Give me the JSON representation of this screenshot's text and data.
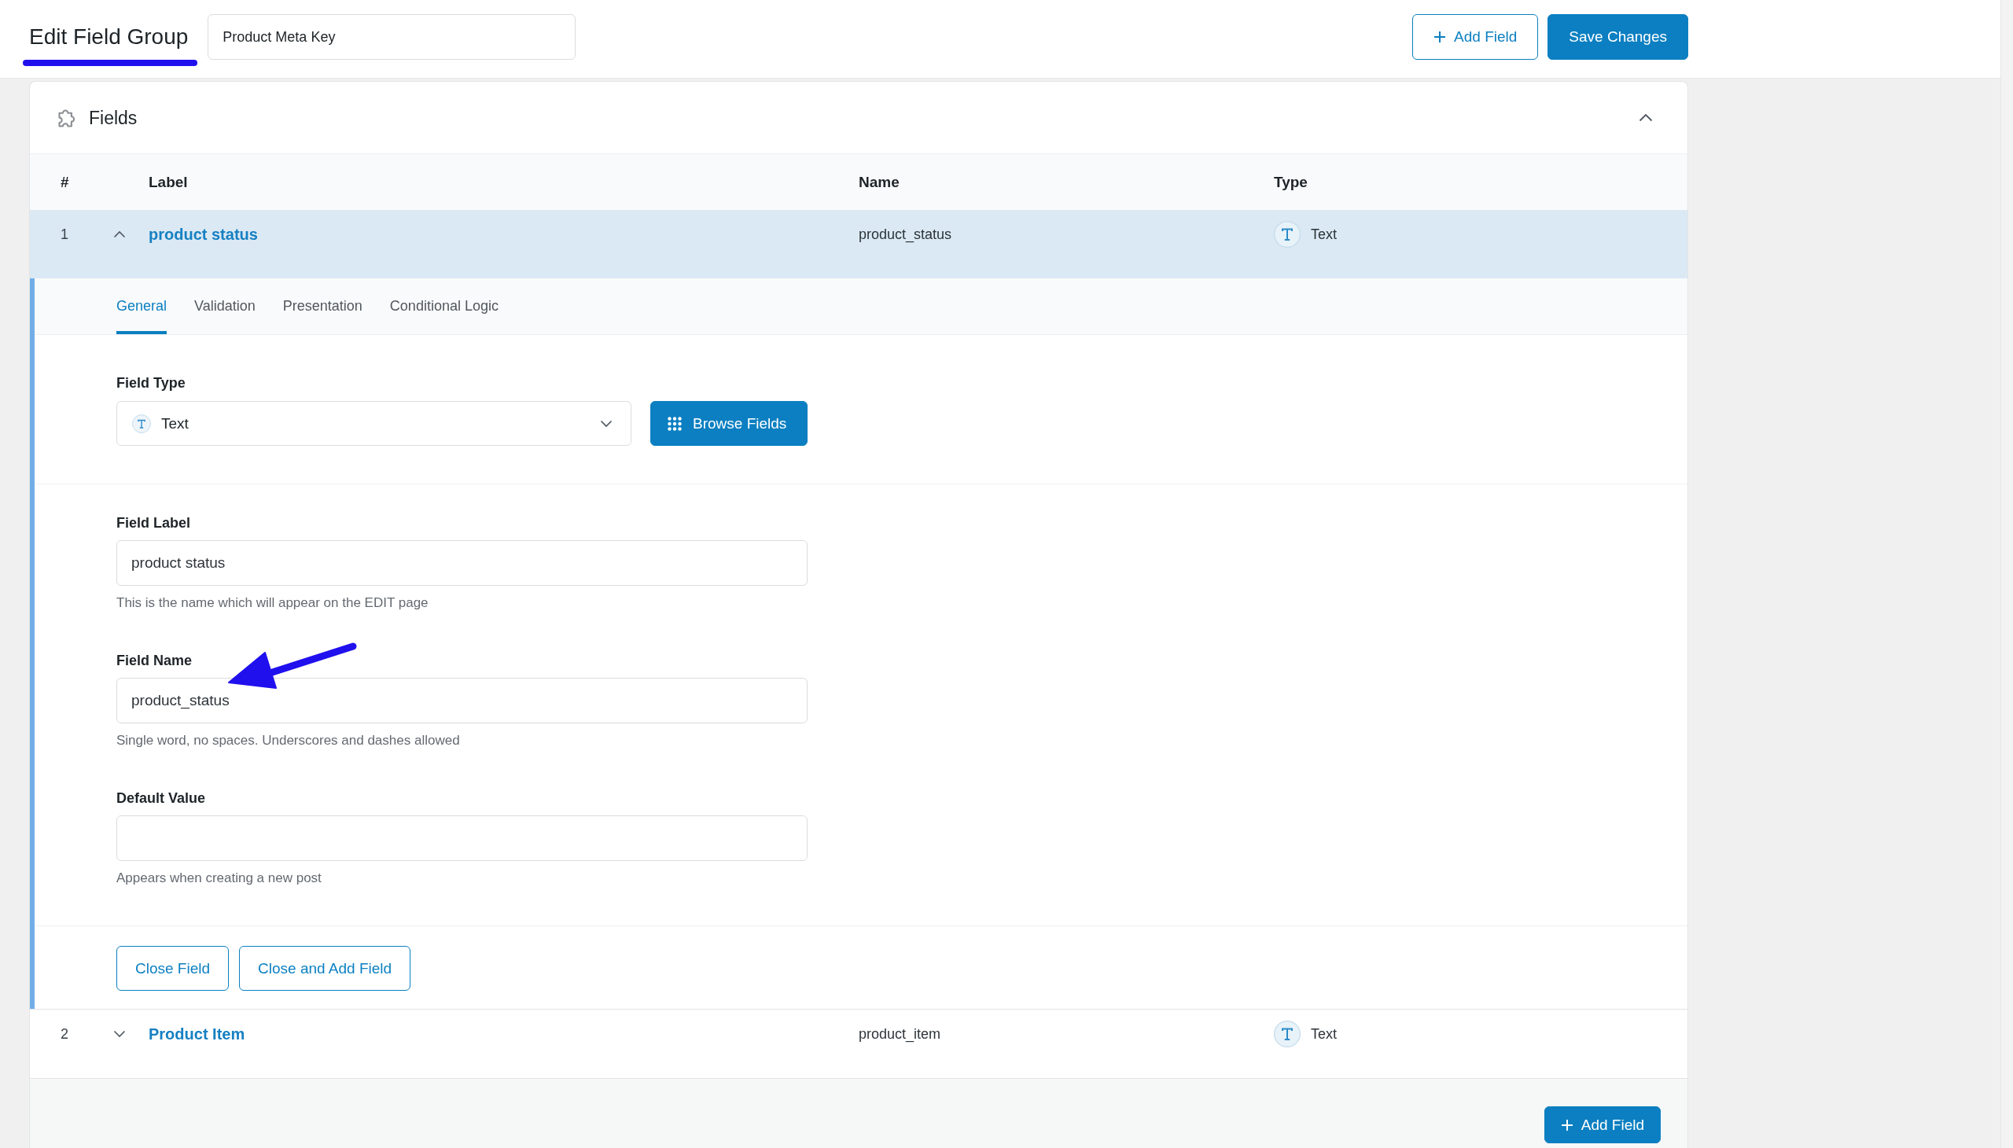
{
  "header": {
    "title": "Edit Field Group",
    "group_name": "Product Meta Key",
    "buttons": [
      {
        "label": "Add Field",
        "kind": "outline"
      },
      {
        "label": "Save Changes",
        "kind": "primary"
      }
    ]
  },
  "fields_panel": {
    "title": "Fields",
    "expanded": true,
    "columns": [
      "#",
      "Label",
      "Name",
      "Type"
    ],
    "rows": [
      {
        "number": "1",
        "label": "product status",
        "name": "product_status",
        "type": "Text",
        "expanded": true,
        "editor": {
          "tabs": [
            {
              "label": "General",
              "selected": true
            },
            {
              "label": "Validation",
              "selected": false
            },
            {
              "label": "Presentation",
              "selected": false
            },
            {
              "label": "Conditional Logic",
              "selected": false
            }
          ],
          "field_type": {
            "label": "Field Type",
            "value": "Text",
            "button": "Browse Fields"
          },
          "inputs": [
            {
              "label": "Field Label",
              "value": "product status",
              "help": "This is the name which will appear on the EDIT page"
            },
            {
              "label": "Field Name",
              "value": "product_status",
              "help": "Single word, no spaces. Underscores and dashes allowed"
            },
            {
              "label": "Default Value",
              "help": "Appears when creating a new post"
            }
          ],
          "actions": [
            "Close Field",
            "Close and Add Field"
          ]
        }
      },
      {
        "number": "2",
        "label": "Product Item",
        "name": "product_item",
        "type": "Text",
        "expanded": false
      }
    ],
    "footer_button": "Add Field"
  }
}
